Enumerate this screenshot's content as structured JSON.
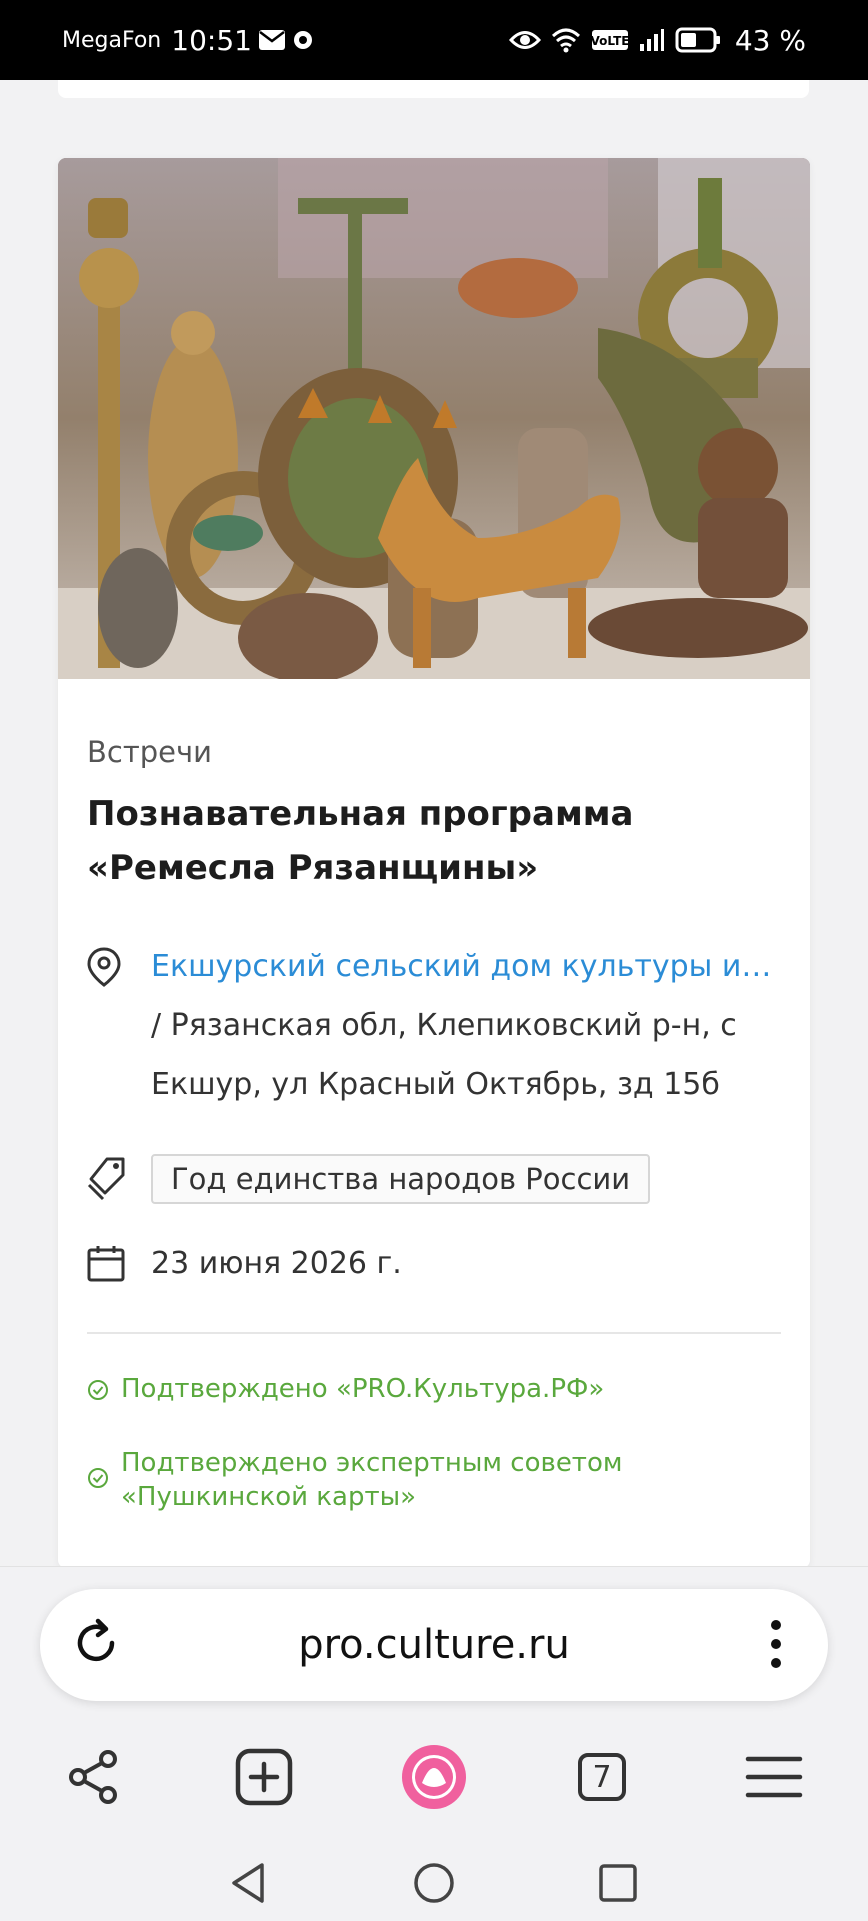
{
  "status_bar": {
    "carrier": "MegaFon",
    "time": "10:51",
    "battery_percent": "43 %"
  },
  "event": {
    "category": "Встречи",
    "title": "Познавательная программа «Ремесла Рязанщины»",
    "place_name": "Екшурский сельский дом культуры им. М...",
    "place_address": "/ Рязанская обл, Клепиковский р-н, с Екшур, ул Красный Октябрь, зд 15б",
    "tag": "Год единства народов России",
    "date": "23 июня 2026 г.",
    "verified": [
      "Подтверждено «PRO.Культура.РФ»",
      "Подтверждено экспертным советом «Пушкинской карты»"
    ]
  },
  "browser": {
    "url": "pro.culture.ru",
    "tabs_count": "7"
  },
  "colors": {
    "link": "#2b8cd6",
    "verified_green": "#5aa83d",
    "alice_pink": "#f0609e"
  }
}
